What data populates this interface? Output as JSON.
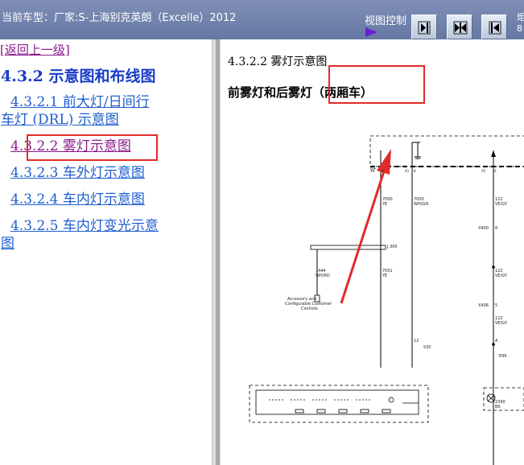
{
  "header": {
    "car_model": "当前车型：厂家:S-上海别克英朗（Excelle）2012",
    "view_control_label": "视图控制",
    "edge_glyphs": "炬\n8"
  },
  "toolbar": {
    "buttons": [
      {
        "name": "next-page-button",
        "icon": "arrow-right-bar-icon"
      },
      {
        "name": "split-view-button",
        "icon": "double-arrow-icon"
      },
      {
        "name": "prev-page-button",
        "icon": "arrow-left-bar-icon"
      }
    ]
  },
  "nav": {
    "back_link": "[返回上一级]",
    "section_title": "4.3.2 示意图和布线图",
    "items": [
      {
        "label_line1": "4.3.2.1 前大灯/日间行",
        "label_line2": "车灯 (DRL) 示意图"
      },
      {
        "label": "4.3.2.2 雾灯示意图",
        "state": "visited"
      },
      {
        "label": "4.3.2.3 车外灯示意图"
      },
      {
        "label": "4.3.2.4 车内灯示意图"
      },
      {
        "label_line1": "4.3.2.5 车内灯变光示意",
        "label_line2": "图"
      }
    ]
  },
  "content": {
    "heading": "4.3.2.2 雾灯示意图",
    "subheading": "前雾灯和后雾灯（两厢车）"
  },
  "diagram_labels": {
    "conn_left": "X8",
    "pin_left": "4",
    "conn_mid": "X1",
    "pin_mid": "8",
    "conn_right": "X5",
    "pin_right": "6",
    "bplus": "B+",
    "wire1_code": "7000",
    "wire1_color": "YE",
    "wire2_code": "7000",
    "wire2_color": "WH/GN",
    "splice": "J.300",
    "wire3_code": "1444",
    "wire3_color": "WH/RD",
    "wire4_code": "7001",
    "wire4_color": "YE",
    "module_line1": "Accessory and",
    "module_line2": "Configurable Customer",
    "module_line3": "Controls",
    "pin_bottom": "12",
    "switch_ref": "S30",
    "wire_r1_code": "122",
    "wire_r1_color": "VE/GY",
    "inline_1": "X400",
    "inline_1_pin": "8",
    "wire_r2_code": "122",
    "wire_r2_color": "VE/GY",
    "inline_2": "X406",
    "inline_2_pin": "5",
    "wire_r3_code": "122",
    "wire_r3_color": "VE/GY",
    "lamp_ref": "E96",
    "lamp_pin": "A",
    "wire_r4_code": "2390",
    "wire_r4_color": "BK"
  },
  "colors": {
    "accent_red": "#e12a2a",
    "link_blue": "#1f5ecf",
    "visited_purple": "#8a1a8a",
    "title_blue": "#1a3cc8"
  }
}
